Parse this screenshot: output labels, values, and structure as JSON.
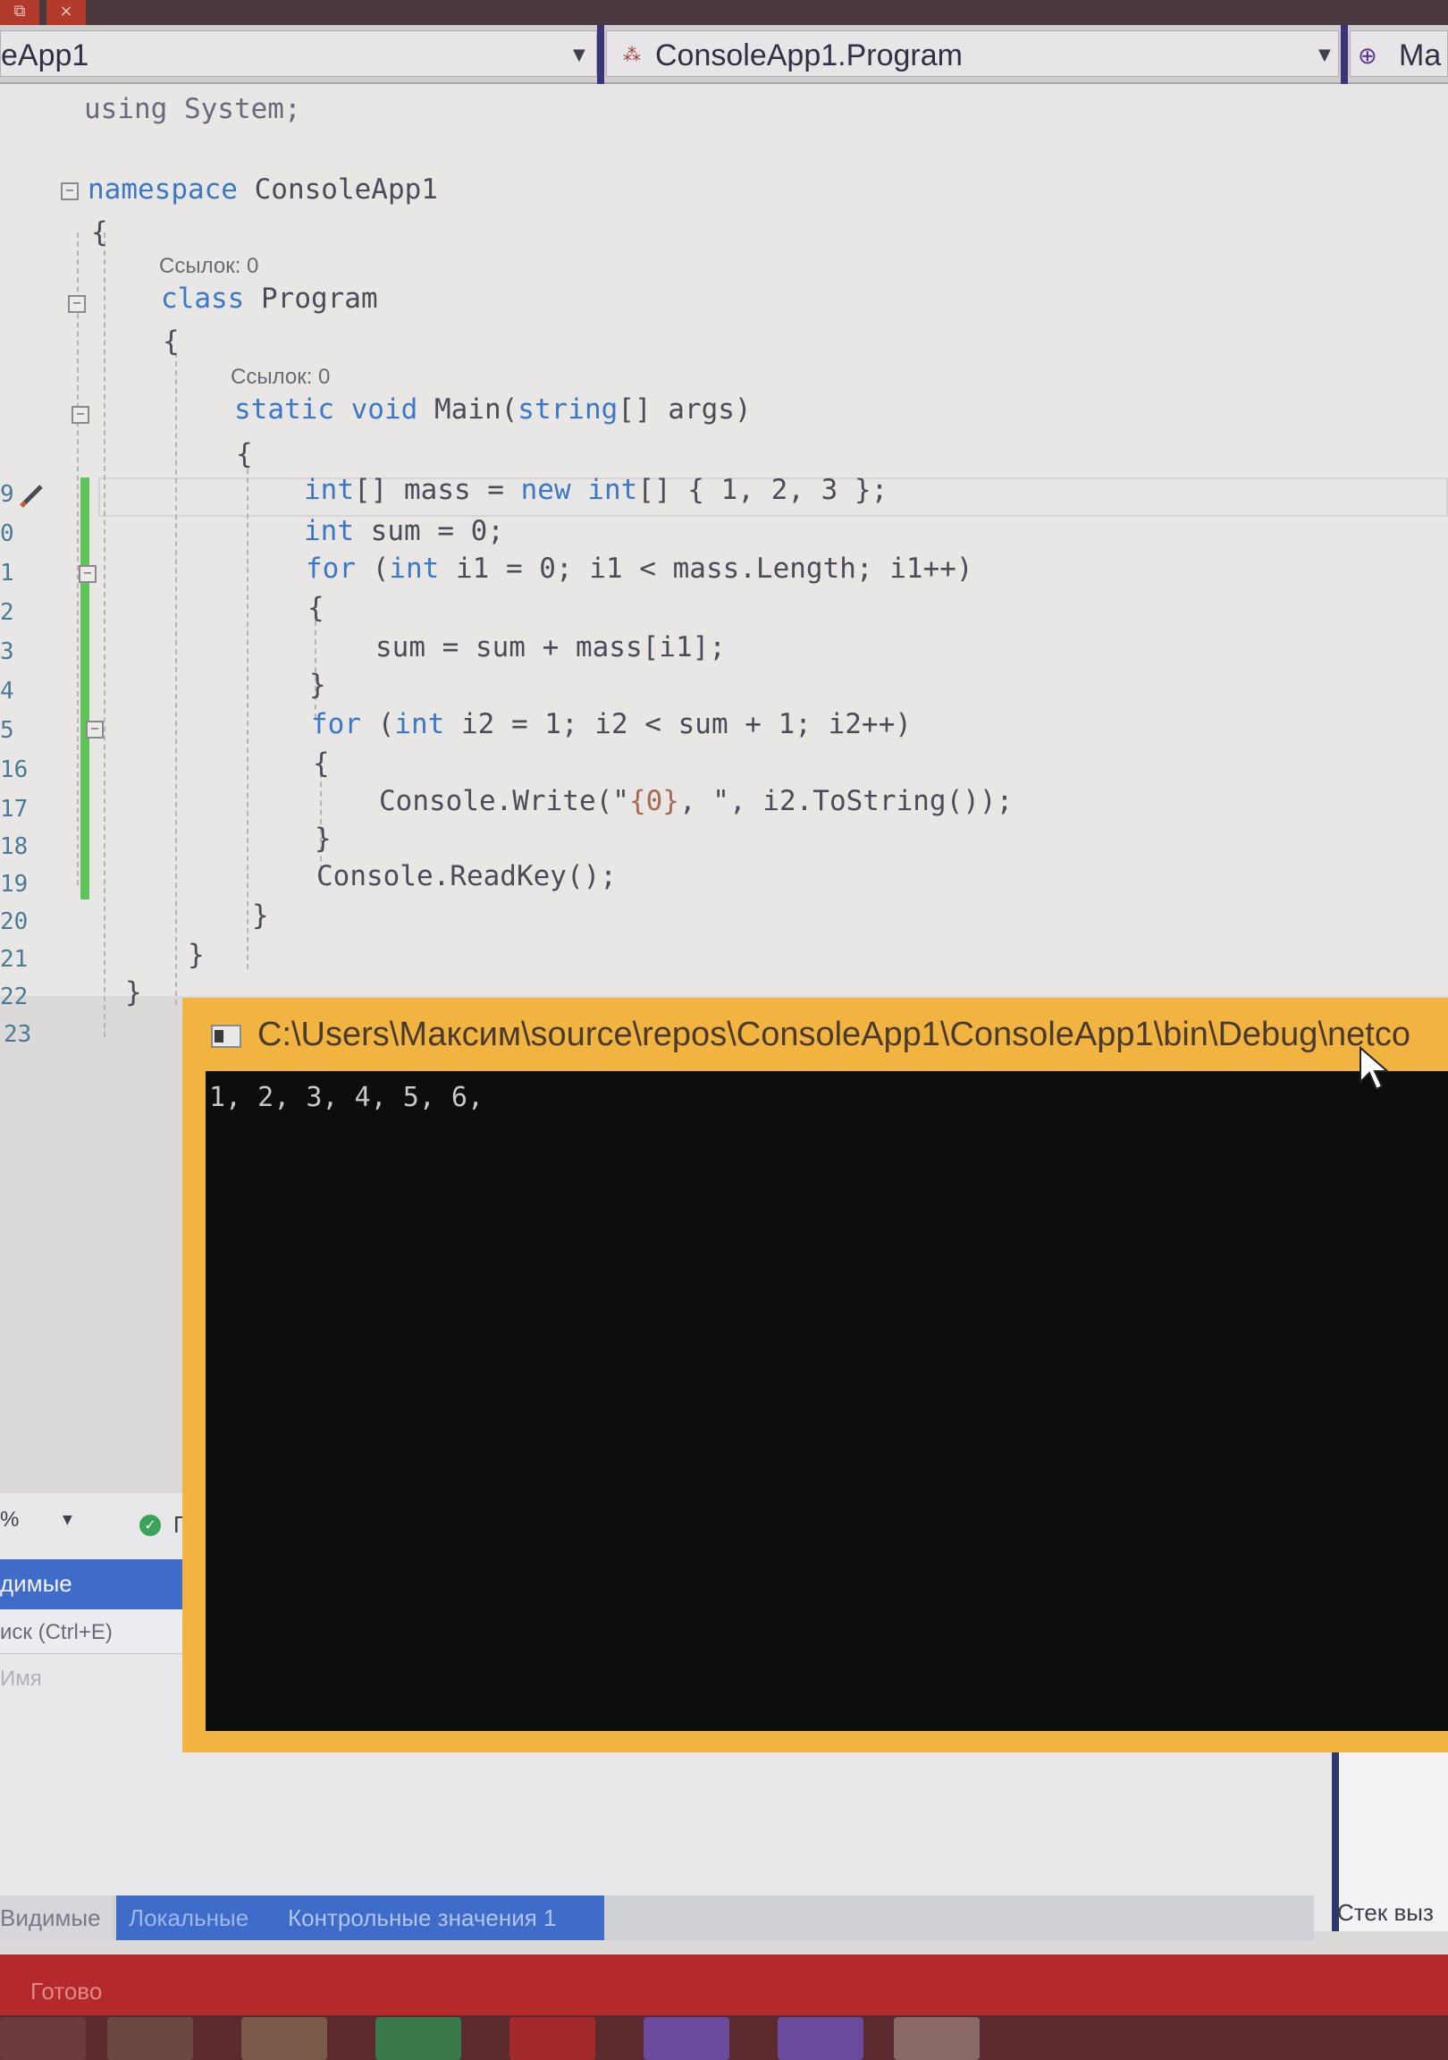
{
  "window": {
    "nav_project": "eApp1",
    "nav_class": "ConsoleApp1.Program",
    "nav_member": "Ma"
  },
  "editor": {
    "codelens": [
      "Ссылок: 0",
      "Ссылок: 0"
    ],
    "line_numbers": [
      "9",
      "0",
      "1",
      "2",
      "3",
      "4",
      "5",
      "16",
      "17",
      "18",
      "19",
      "20",
      "21",
      "22",
      "23"
    ],
    "lines": {
      "using": "using System;",
      "namespace_kw": "namespace",
      "namespace_name": " ConsoleApp1",
      "brace_open": "{",
      "brace_close": "}",
      "class_kw": "class",
      "class_name": " Program",
      "main_static": "static",
      "main_void": " void",
      "main_name": " Main(",
      "main_string": "string",
      "main_args": "[] args)",
      "l9_a": "int",
      "l9_b": "[] mass = ",
      "l9_c": "new",
      "l9_d": " ",
      "l9_e": "int",
      "l9_f": "[] { 1, 2, 3 };",
      "l10_a": "int",
      "l10_b": " sum = 0;",
      "for_kw": "for",
      "l11_a": " (",
      "int_kw": "int",
      "l11_b": " i1 = 0; i1 < mass.Length; i1++)",
      "l13": "sum = sum + mass[i1];",
      "l15_b": " i2 = 1; i2 < sum + 1; i2++)",
      "l17_a": "Console.Write(\"",
      "l17_b": "{0}",
      "l17_c": ", \", i2.ToString());",
      "l19": "Console.ReadKey();"
    }
  },
  "console": {
    "title": "C:\\Users\\Максим\\source\\repos\\ConsoleApp1\\ConsoleApp1\\bin\\Debug\\netco",
    "output": "1, 2, 3, 4, 5, 6,"
  },
  "panel": {
    "zoom": "%",
    "issues_label": "Пр",
    "autos_header": "димые",
    "search_placeholder": "иск (Ctrl+E)",
    "column_name": "Имя",
    "callstack_label": "Стек выз"
  },
  "bottom_tabs": [
    "Видимые",
    "Локальные",
    "Контрольные значения 1"
  ],
  "status": "Готово",
  "colors": {
    "accent": "#3f6cc9",
    "console_frame": "#f2b440",
    "statusbar": "#b4292b",
    "change_marker": "#5fc45a",
    "keyword": "#3b78c8"
  }
}
